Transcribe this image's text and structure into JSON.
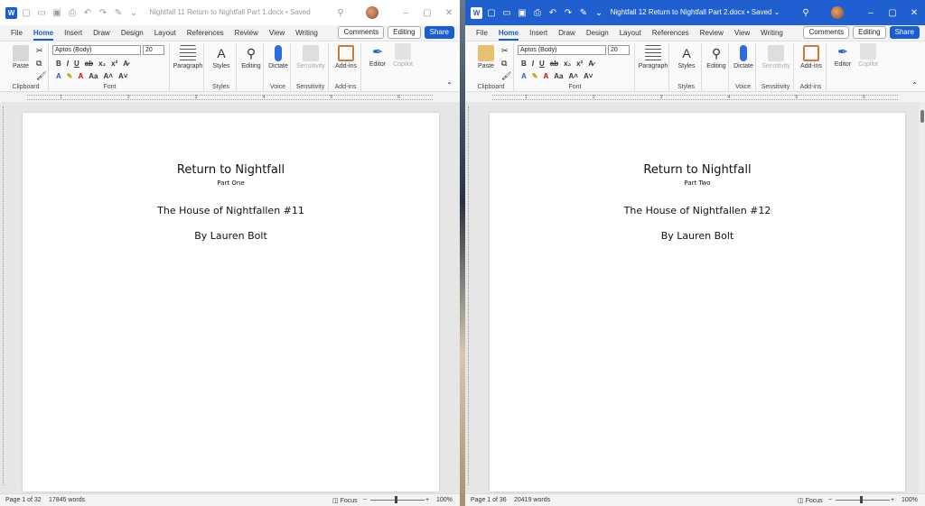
{
  "left": {
    "title": "Nightfall 11 Return to Nightfall Part 1.docx • Saved",
    "tabs": [
      "File",
      "Home",
      "Insert",
      "Draw",
      "Design",
      "Layout",
      "References",
      "Review",
      "View",
      "Writing"
    ],
    "comments": "Comments",
    "editing": "Editing",
    "share": "Share",
    "font_name": "Aptos (Body)",
    "font_size": "20",
    "groups": {
      "clipboard": "Clipboard",
      "font": "Font",
      "styles": "Styles",
      "voice": "Voice",
      "sensitivity": "Sensitivity",
      "addins": "Add-ins"
    },
    "buttons": {
      "paste": "Paste",
      "paragraph": "Paragraph",
      "styles": "Styles",
      "editing": "Editing",
      "dictate": "Dictate",
      "sensitivity": "Sensitivity",
      "addins": "Add-ins",
      "editor": "Editor",
      "copilot": "Copilot"
    },
    "doc": {
      "title": "Return to Nightfall",
      "part": "Part One",
      "house": "The House of Nightfallen #11",
      "by": "By Lauren Bolt"
    },
    "status": {
      "page": "Page 1 of 32",
      "words": "17845 words",
      "focus": "Focus",
      "zoom": "100%"
    }
  },
  "right": {
    "title": "Nightfall 12 Return to Nightfall Part 2.docx • Saved",
    "tabs": [
      "File",
      "Home",
      "Insert",
      "Draw",
      "Design",
      "Layout",
      "References",
      "Review",
      "View",
      "Writing"
    ],
    "comments": "Comments",
    "editing": "Editing",
    "share": "Share",
    "font_name": "Aptos (Body)",
    "font_size": "20",
    "groups": {
      "clipboard": "Clipboard",
      "font": "Font",
      "styles": "Styles",
      "voice": "Voice",
      "sensitivity": "Sensitivity",
      "addins": "Add-ins"
    },
    "buttons": {
      "paste": "Paste",
      "paragraph": "Paragraph",
      "styles": "Styles",
      "editing": "Editing",
      "dictate": "Dictate",
      "sensitivity": "Sensitivity",
      "addins": "Add-ins",
      "editor": "Editor",
      "copilot": "Copilot"
    },
    "doc": {
      "title": "Return to Nightfall",
      "part": "Part Two",
      "house": "The House of Nightfallen #12",
      "by": "By Lauren Bolt"
    },
    "status": {
      "page": "Page 1 of 36",
      "words": "20419 words",
      "focus": "Focus",
      "zoom": "100%"
    }
  },
  "colors": {
    "accent": "#1a5bd6",
    "active_titlebar": "#1f5fd0"
  }
}
